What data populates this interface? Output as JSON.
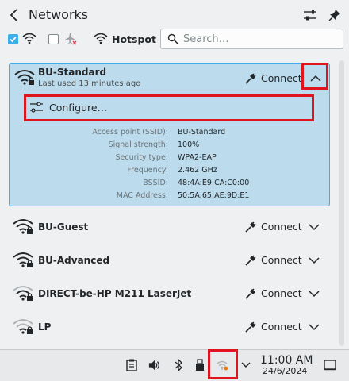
{
  "header": {
    "title": "Networks"
  },
  "toolbar": {
    "wifi_enabled": true,
    "airplane_enabled": false,
    "hotspot_label": "Hotspot",
    "search_placeholder": "Search…"
  },
  "expanded_network": {
    "name": "BU-Standard",
    "subtitle": "Last used 13 minutes ago",
    "connect_label": "Connect",
    "configure_label": "Configure…",
    "details": [
      {
        "key": "Access point (SSID):",
        "value": "BU-Standard"
      },
      {
        "key": "Signal strength:",
        "value": "100%"
      },
      {
        "key": "Security type:",
        "value": "WPA2-EAP"
      },
      {
        "key": "Frequency:",
        "value": "2.462 GHz"
      },
      {
        "key": "BSSID:",
        "value": "48:4A:E9:CA:C0:00"
      },
      {
        "key": "MAC Address:",
        "value": "50:5A:65:AE:9D:E1"
      }
    ]
  },
  "networks": [
    {
      "name": "BU-Guest",
      "connect_label": "Connect",
      "signal": "full"
    },
    {
      "name": "BU-Advanced",
      "connect_label": "Connect",
      "signal": "full"
    },
    {
      "name": "DIRECT-be-HP M211 LaserJet",
      "connect_label": "Connect",
      "signal": "medium"
    },
    {
      "name": "LP",
      "connect_label": "Connect",
      "signal": "low"
    }
  ],
  "taskbar": {
    "time": "11:00 AM",
    "date": "24/6/2024"
  },
  "colors": {
    "accent": "#3daee9",
    "selection_bg": "#bcdcee",
    "highlight_box": "#e0141e"
  }
}
